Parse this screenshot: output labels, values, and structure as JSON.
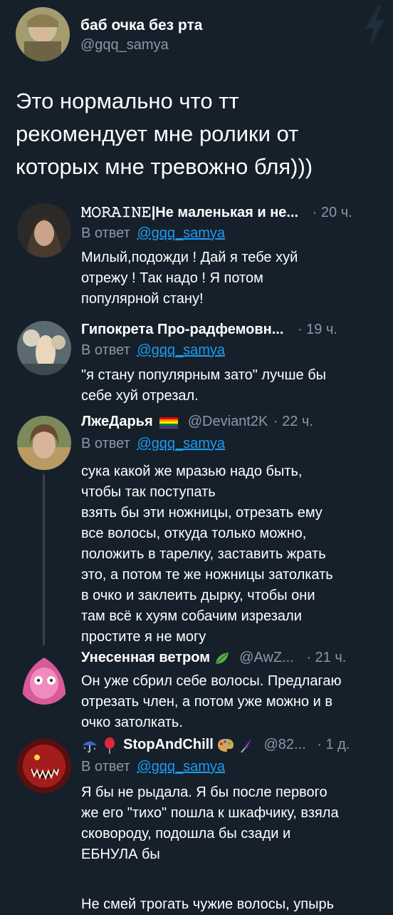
{
  "main_tweet": {
    "author_name": "баб очка без рта",
    "author_handle": "@gqq_samya",
    "text": "Это нормально что тт рекомендует мне ролики от которых мне тревожно бля)))",
    "bolt_icon": "lightning-bolt-icon"
  },
  "replies": [
    {
      "name": "𝙼𝙾𝚁𝙰𝙸𝙽𝙴|Не маленькая и не...",
      "handle": "",
      "time": "· 20 ч.",
      "reply_prefix": "В ответ",
      "reply_to": "@gqq_samya",
      "text_lines": [
        "Милый,подожди ! Дай я тебе хуй",
        "отрежу ! Так надо ! Я потом",
        "популярной стану!"
      ]
    },
    {
      "name": "Гипокрета Про-радфемовн...",
      "handle": "",
      "time": "· 19 ч.",
      "reply_prefix": "В ответ",
      "reply_to": "@gqq_samya",
      "text_lines": [
        "\"я стану популярным зато\" лучше бы",
        "себе хуй отрезал."
      ]
    },
    {
      "name": "ЛжеДарья",
      "handle": "@Deviant2K",
      "time": "· 22 ч.",
      "reply_prefix": "В ответ",
      "reply_to": "@gqq_samya",
      "text_lines": [
        "сука какой же мразью надо быть,",
        "чтобы так поступать",
        "взять бы эти ножницы, отрезать ему",
        "все волосы, откуда только можно,",
        "положить в тарелку, заставить жрать",
        "это, а потом те же ножницы затолкать",
        "в очко и заклеить дырку, чтобы они",
        "там всё к хуям собачим изрезали",
        "простите я не могу"
      ]
    },
    {
      "name": "Унесенная ветром",
      "handle": "@AwZ...",
      "time": "· 21 ч.",
      "text_lines": [
        "Он уже сбрил себе волосы. Предлагаю",
        "отрезать член, а потом уже можно и в",
        "очко затолкать."
      ]
    },
    {
      "name": "StopAndChill",
      "handle": "@82...",
      "time": "· 1 д.",
      "reply_prefix": "В ответ",
      "reply_to": "@gqq_samya",
      "text_lines": [
        "Я бы не рыдала. Я бы после первого",
        "же его \"тихо\" пошла к шкафчику, взяла",
        "сковороду, подошла бы сзади и",
        "ЕБНУЛА бы",
        "",
        "Не смей трогать чужие волосы, упырь"
      ]
    }
  ],
  "colors": {
    "background": "#15202b",
    "muted": "#8899a6",
    "link": "#1d9bf0",
    "thread_line": "#38444d"
  }
}
